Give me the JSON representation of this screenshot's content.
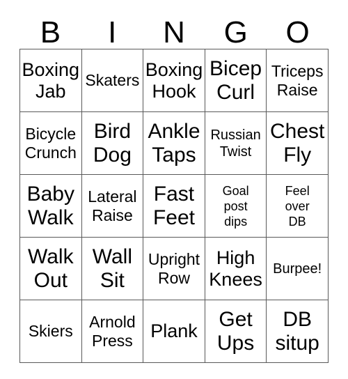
{
  "card": {
    "header_letters": [
      "B",
      "I",
      "N",
      "G",
      "O"
    ],
    "border_color": "#595959",
    "background_color": "#ffffff",
    "text_color": "#000000",
    "rows": [
      [
        {
          "text": "Boxing\nJab",
          "size": "lg"
        },
        {
          "text": "Skaters",
          "size": "md"
        },
        {
          "text": "Boxing\nHook",
          "size": "lg"
        },
        {
          "text": "Bicep\nCurl",
          "size": "xl"
        },
        {
          "text": "Triceps\nRaise",
          "size": "md"
        }
      ],
      [
        {
          "text": "Bicycle\nCrunch",
          "size": "md"
        },
        {
          "text": "Bird\nDog",
          "size": "xl"
        },
        {
          "text": "Ankle\nTaps",
          "size": "xl"
        },
        {
          "text": "Russian\nTwist",
          "size": "sm"
        },
        {
          "text": "Chest\nFly",
          "size": "xl"
        }
      ],
      [
        {
          "text": "Baby\nWalk",
          "size": "xl"
        },
        {
          "text": "Lateral\nRaise",
          "size": "md"
        },
        {
          "text": "Fast\nFeet",
          "size": "xl"
        },
        {
          "text": "Goal\npost\ndips",
          "size": "xs"
        },
        {
          "text": "Feel\nover\nDB",
          "size": "xs"
        }
      ],
      [
        {
          "text": "Walk\nOut",
          "size": "xl"
        },
        {
          "text": "Wall\nSit",
          "size": "xl"
        },
        {
          "text": "Upright\nRow",
          "size": "md"
        },
        {
          "text": "High\nKnees",
          "size": "lg"
        },
        {
          "text": "Burpee!",
          "size": "sm"
        }
      ],
      [
        {
          "text": "Skiers",
          "size": "md"
        },
        {
          "text": "Arnold\nPress",
          "size": "md"
        },
        {
          "text": "Plank",
          "size": "lg"
        },
        {
          "text": "Get\nUps",
          "size": "xl"
        },
        {
          "text": "DB\nsitup",
          "size": "xl"
        }
      ]
    ]
  }
}
